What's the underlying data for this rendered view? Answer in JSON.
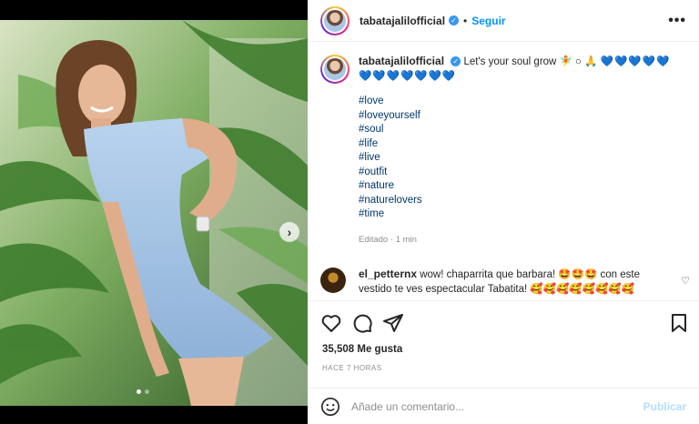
{
  "post": {
    "username": "tabatajalilofficial",
    "header_username": "tabatajalilofficial",
    "separator": "•",
    "follow_label": "Seguir",
    "more_label": "•••",
    "caption_text": "Let's your soul grow 🧚 ○ 🙏",
    "caption_hearts_1": "💙💙💙💙💙",
    "caption_hearts_2": "💙💙💙💙💙💙💙",
    "hashtags": [
      "#love",
      "#loveyourself",
      "#soul",
      "#life",
      "#live",
      "#outfit",
      "#nature",
      "#naturelovers",
      "#time"
    ],
    "edited_label": "Editado · 1 min"
  },
  "comment": {
    "username": "el_petternx",
    "text": "wow! chaparrita que barbara! 🤩🤩🤩 con este vestido te ves espectacular Tabatita! 🥰🥰🥰🥰🥰🥰🥰🥰"
  },
  "stats": {
    "likes": "35,508 Me gusta",
    "time_ago": "HACE 7 HORAS"
  },
  "composer": {
    "placeholder": "Añade un comentario...",
    "publish_label": "Publicar"
  },
  "icons": {
    "verified": "verified-badge-icon",
    "heart": "heart-icon",
    "comment": "comment-icon",
    "share": "share-icon",
    "save": "bookmark-icon",
    "emoji": "emoji-icon",
    "next": "chevron-right-icon"
  },
  "colors": {
    "accent": "#0095f6",
    "hashtag": "#00376b",
    "muted": "#8e8e8e",
    "dress": "#a9c6e6"
  }
}
